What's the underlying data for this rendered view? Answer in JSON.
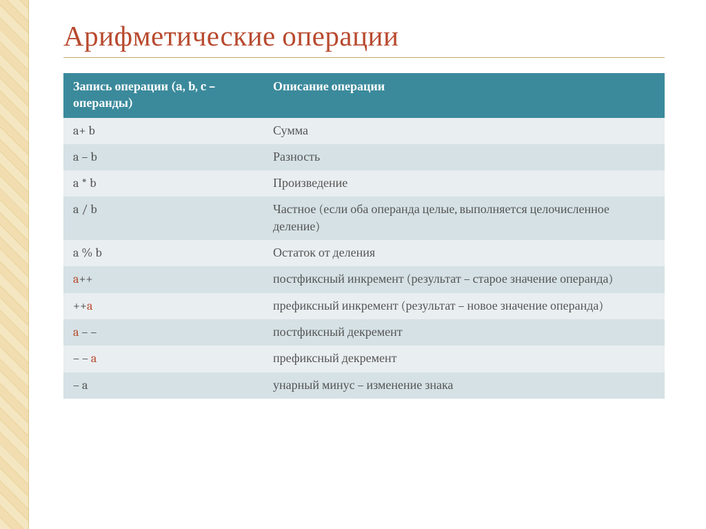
{
  "slide": {
    "title": "Арифметические операции"
  },
  "table": {
    "header": {
      "col1": "Запись операции (a, b, c – операнды)",
      "col2": "Описание операции"
    },
    "rows": [
      {
        "op": "a+ b",
        "highlight_a": false,
        "desc": "Сумма"
      },
      {
        "op": "a – b",
        "highlight_a": false,
        "desc": "Разность"
      },
      {
        "op": "a * b",
        "highlight_a": false,
        "desc": "Произведение"
      },
      {
        "op": "a / b",
        "highlight_a": false,
        "desc": "Частное (если оба операнда целые, выполняется целочисленное деление)"
      },
      {
        "op": "a % b",
        "highlight_a": false,
        "desc": "Остаток от деления"
      },
      {
        "op_a": "a",
        "op_rest": "++",
        "highlight_a": true,
        "desc": "постфиксный инкремент (результат – старое значение операнда)"
      },
      {
        "op_a": "++",
        "op_rest": "a",
        "reversed": true,
        "highlight_a": true,
        "desc": "префиксный инкремент (результат – новое значение операнда)"
      },
      {
        "op_a": "a",
        "op_rest": " – –",
        "highlight_a": true,
        "desc": "постфиксный декремент"
      },
      {
        "op_a": "– – ",
        "op_rest": "a",
        "reversed": true,
        "highlight_a": true,
        "desc": "префиксный декремент"
      },
      {
        "op": "– a",
        "highlight_a": false,
        "desc": "унарный минус – изменение знака"
      }
    ]
  }
}
